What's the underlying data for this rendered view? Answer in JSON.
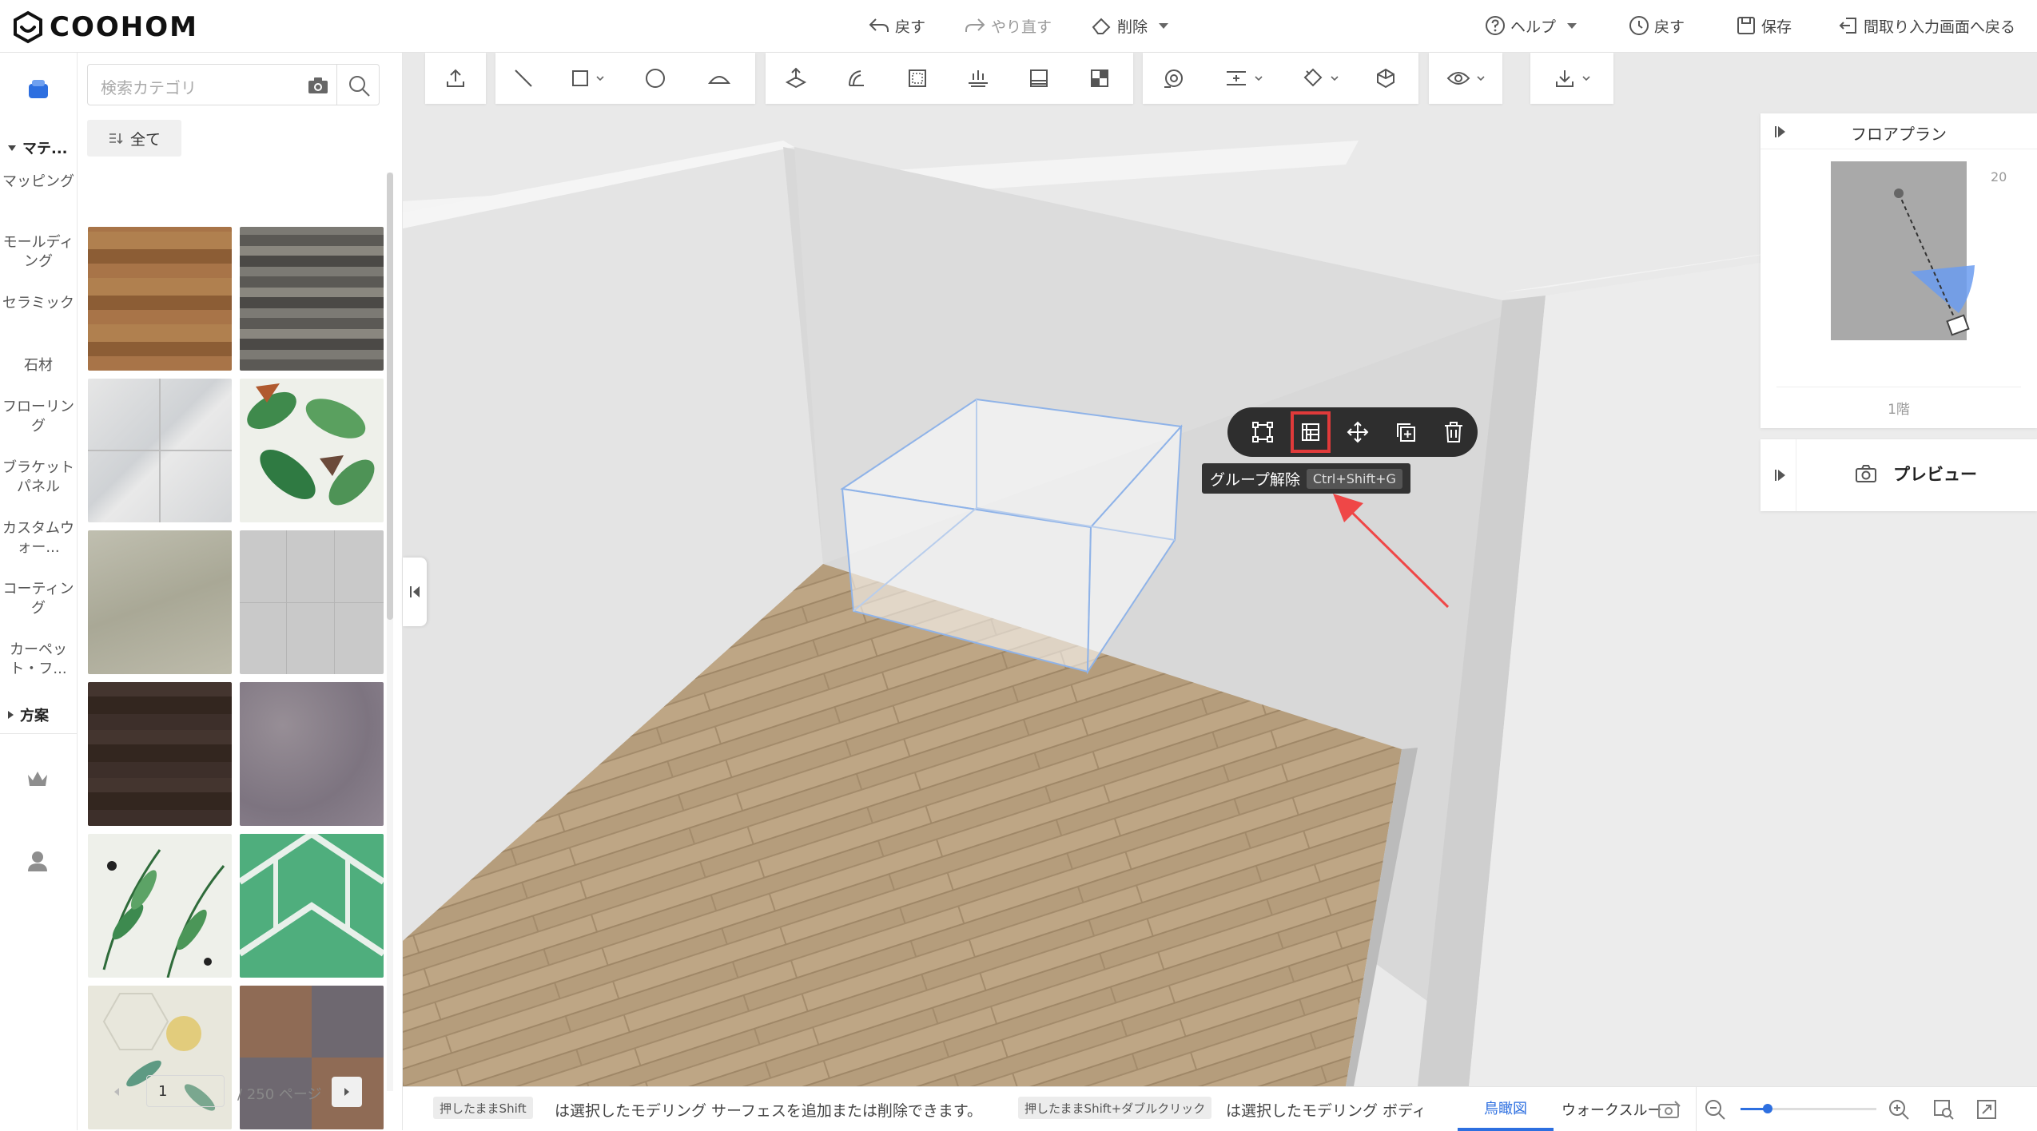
{
  "app": {
    "brand": "COOHOM"
  },
  "topbar": {
    "undo": "戻す",
    "redo": "やり直す",
    "delete": "削除",
    "help": "ヘルプ",
    "history": "戻す",
    "save": "保存",
    "back_to_floorplan": "間取り入力画面へ戻る"
  },
  "rail": {
    "section_material": "マテ...",
    "items": [
      "マッピング",
      "モールディング",
      "セラミック",
      "石材",
      "フローリング",
      "ブラケットパネル",
      "カスタムウォー...",
      "コーティング",
      "カーペット・フ..."
    ],
    "section_plan": "方案"
  },
  "panel": {
    "search_placeholder": "検索カテゴリ",
    "all_label": "全て",
    "page_current": "1",
    "page_total": "/ 250 ページ",
    "swatches": [
      {
        "name": "wood-oak",
        "color": "#9a6b3e"
      },
      {
        "name": "stone-dark-strips",
        "color": "#6a6762"
      },
      {
        "name": "marble-white",
        "color": "#dcdcdc"
      },
      {
        "name": "tropical-leaves",
        "color": "#4f8f5a"
      },
      {
        "name": "concrete-beige",
        "color": "#b8b6a6"
      },
      {
        "name": "tile-grey",
        "color": "#c8c8c8"
      },
      {
        "name": "wood-dark",
        "color": "#3b2d28"
      },
      {
        "name": "granite-mauve",
        "color": "#8b8189"
      },
      {
        "name": "leaf-pattern",
        "color": "#e9ece4"
      },
      {
        "name": "green-geometric",
        "color": "#4fae7d"
      },
      {
        "name": "floral-hexagon",
        "color": "#e5e4d8"
      },
      {
        "name": "carpet-tiles",
        "color": "#7d6356"
      }
    ]
  },
  "toolbar": {
    "tools": [
      "upload",
      "line",
      "rectangle",
      "circle",
      "arc",
      "push-pull",
      "offset",
      "surface",
      "align",
      "panel",
      "split",
      "camera",
      "distribute",
      "paint",
      "material",
      "view",
      "download"
    ]
  },
  "floatbar": {
    "tooltip_label": "グループ解除",
    "tooltip_shortcut": "Ctrl+Shift+G"
  },
  "floorplan": {
    "title": "フロアプラン",
    "floor_label": "1階",
    "zoom_badge": "20"
  },
  "preview": {
    "label": "プレビュー"
  },
  "status": {
    "hint1_key": "押したままShift",
    "hint1_text": "は選択したモデリング サーフェスを追加または削除できます。",
    "hint2_key": "押したままShift+ダブルクリック",
    "hint2_text": "は選択したモデリング ボディを",
    "tab_birdseye": "鳥瞰図",
    "tab_walkthrough": "ウォークスルー",
    "zoom_level": 0.2
  },
  "colors": {
    "accent": "#2d6fe0",
    "highlight": "#e03a3a",
    "arrow": "#ef4747"
  }
}
